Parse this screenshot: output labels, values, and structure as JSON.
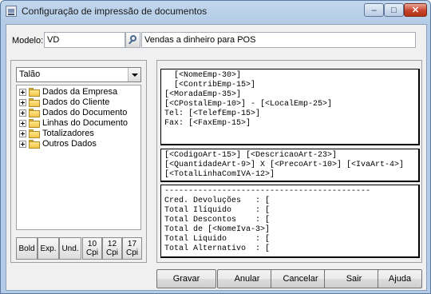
{
  "window": {
    "title": "Configuração de impressão de documentos",
    "controls": {
      "minimize": "–",
      "maximize": "□",
      "close": "✕"
    }
  },
  "modelo": {
    "label": "Modelo:",
    "code": "VD",
    "description": "Vendas a dinheiro para POS"
  },
  "left": {
    "combo_value": "Talão",
    "tree": [
      "Dados da Empresa",
      "Dados do Cliente",
      "Dados do Documento",
      "Linhas do Documento",
      "Totalizadores",
      "Outros Dados"
    ],
    "format_buttons": [
      "Bold",
      "Exp.",
      "Und.",
      "10\nCpi",
      "12\nCpi",
      "17\nCpi"
    ]
  },
  "document": {
    "header_lines": [
      "  [<NomeEmp-30>]",
      "  [<ContribEmp-15>]",
      "",
      "[<MoradaEmp-35>]",
      "[<CPostalEmp-10>] - [<LocalEmp-25>]",
      "Tel: [<TelefEmp-15>]",
      "Fax: [<FaxEmp-15>]"
    ],
    "line_lines": [
      "[<CodigoArt-15>] [<DescricaoArt-23>]",
      "[<QuantidadeArt-9>] X [<PrecoArt-10>] [<IvaArt-4>]",
      "[<TotalLinhaComIVA-12>]"
    ],
    "footer_lines": [
      "-------------------------------------------",
      "Cred. Devoluções   : [",
      "Total Ilíquido     : [",
      "Total Descontos    : [",
      "Total de [<NomeIva-3>]",
      "Total Liquido      : [",
      "Total Alternativo  : ["
    ]
  },
  "actions": [
    "Gravar",
    "Anular",
    "Cancelar",
    "Sair",
    "Ajuda"
  ],
  "colors": {
    "window_frame": "#b3cbe6",
    "close_button": "#c8432c",
    "folder": "#f3c64a"
  }
}
